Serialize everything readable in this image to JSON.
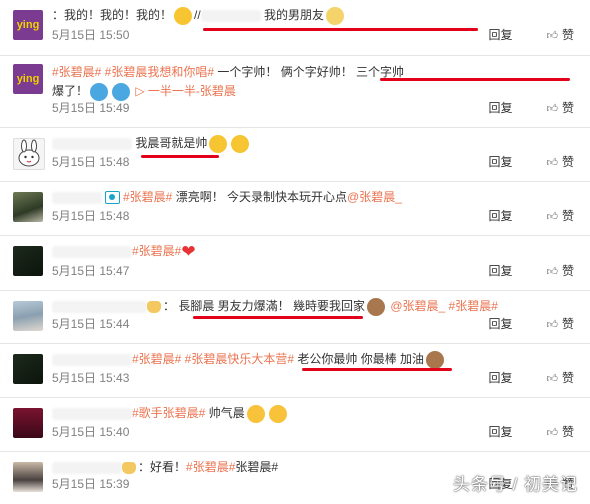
{
  "comments": [
    {
      "avatar": "ying-avatar",
      "avatar_text": "ying",
      "avatar_bg": "#7a3b90",
      "parts": [
        {
          "t": "plain",
          "v": "：我的！我的！我的！"
        },
        {
          "t": "emoji",
          "v": "smirk"
        },
        {
          "t": "plain",
          "v": "//"
        },
        {
          "t": "blur",
          "w": 60
        },
        {
          "t": "plain",
          "v": " 我的男朋友"
        },
        {
          "t": "emoji",
          "v": "cat"
        }
      ],
      "time": "5月15日 15:50",
      "reply": "回复",
      "like": "赞"
    },
    {
      "avatar": "ying-avatar",
      "avatar_text": "ying",
      "avatar_bg": "#7a3b90",
      "parts": [
        {
          "t": "tag",
          "v": "#张碧晨# #张碧晨我想和你唱#"
        },
        {
          "t": "plain",
          "v": " 一个字帅！ 俩个字好帅！ 三个字帅"
        }
      ],
      "line2": "爆了！",
      "line2_tail": "一半一半-张碧晨",
      "time": "5月15日 15:49",
      "reply": "回复",
      "like": "赞"
    },
    {
      "avatar": "rabbit-avatar",
      "parts": [
        {
          "t": "blur",
          "w": 80
        },
        {
          "t": "plain",
          "v": " 我晨哥就是帅"
        },
        {
          "t": "emoji",
          "v": "smile"
        },
        {
          "t": "emoji",
          "v": "smile"
        }
      ],
      "time": "5月15日 15:48",
      "reply": "回复",
      "like": "赞"
    },
    {
      "avatar": "photo-avatar",
      "parts": [
        {
          "t": "blur",
          "w": 50
        },
        {
          "t": "camera"
        },
        {
          "t": "tag",
          "v": "#张碧晨#"
        },
        {
          "t": "plain",
          "v": " 漂亮啊！ 今天录制快本玩开心点"
        },
        {
          "t": "at",
          "v": "@张碧晨_"
        }
      ],
      "time": "5月15日 15:48",
      "reply": "回复",
      "like": "赞"
    },
    {
      "avatar": "dark-avatar",
      "parts": [
        {
          "t": "blur",
          "w": 80
        },
        {
          "t": "tag",
          "v": "#张碧晨#"
        },
        {
          "t": "heart"
        }
      ],
      "time": "5月15日 15:47",
      "reply": "回复",
      "like": "赞"
    },
    {
      "avatar": "girl-avatar",
      "parts": [
        {
          "t": "blur",
          "w": 95
        },
        {
          "t": "doll"
        },
        {
          "t": "plain",
          "v": "： 長腳晨 男友力爆滿！ 幾時要我回家"
        },
        {
          "t": "emoji",
          "v": "monkey"
        },
        {
          "t": "at",
          "v": " @张碧晨_ "
        },
        {
          "t": "tag",
          "v": "#张碧晨#"
        }
      ],
      "time": "5月15日 15:44",
      "reply": "回复",
      "like": "赞"
    },
    {
      "avatar": "dark-avatar",
      "parts": [
        {
          "t": "blur",
          "w": 80
        },
        {
          "t": "tag",
          "v": "#张碧晨# #张碧晨快乐大本营#"
        },
        {
          "t": "plain",
          "v": " 老公你最帅 你最棒 加油"
        },
        {
          "t": "emoji",
          "v": "monkey"
        }
      ],
      "time": "5月15日 15:43",
      "reply": "回复",
      "like": "赞"
    },
    {
      "avatar": "singer-avatar",
      "parts": [
        {
          "t": "blur",
          "w": 80
        },
        {
          "t": "tag",
          "v": "#歌手张碧晨#"
        },
        {
          "t": "plain",
          "v": " 帅气晨"
        },
        {
          "t": "emoji",
          "v": "hearteyes"
        },
        {
          "t": "emoji",
          "v": "hearteyes"
        }
      ],
      "time": "5月15日 15:40",
      "reply": "回复",
      "like": "赞"
    },
    {
      "avatar": "portrait-avatar",
      "parts": [
        {
          "t": "blur",
          "w": 70
        },
        {
          "t": "doll"
        },
        {
          "t": "plain",
          "v": "：好看！"
        },
        {
          "t": "tag",
          "v": "#张碧晨#"
        },
        {
          "t": "plain",
          "v": "张碧晨#"
        }
      ],
      "time": "5月15日 15:39",
      "reply": "回复",
      "like": "赞"
    }
  ],
  "watermark": "头条号 / 初美记",
  "colors": {
    "tag": "#eb7350",
    "underline": "#e2001a",
    "meta": "#808080"
  }
}
